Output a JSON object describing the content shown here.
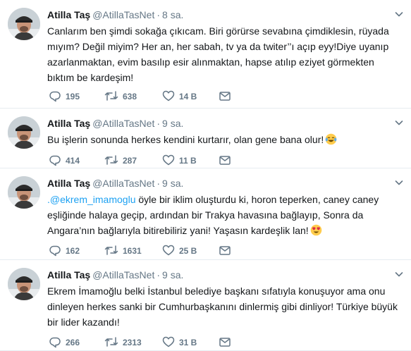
{
  "tweets": [
    {
      "name": "Atilla Taş",
      "handle": "@AtillaTasNet",
      "separator": "·",
      "time": "8 sa.",
      "mention": "",
      "text": "Canlarım ben şimdi sokağa çıkıcam. Biri görürse sevabına çimdiklesin, rüyada mıyım? Değil miyim? Her an, her sabah, tv ya da twiter’’ı açıp eyy!Diye uyanıp azarlanmaktan, evim basılıp esir alınmaktan, hapse atılıp eziyet görmekten bıktım be kardeşim!",
      "emoji": "",
      "replies": "195",
      "retweets": "638",
      "likes": "14 B"
    },
    {
      "name": "Atilla Taş",
      "handle": "@AtillaTasNet",
      "separator": "·",
      "time": "9 sa.",
      "mention": "",
      "text": "Bu işlerin sonunda herkes kendini kurtarır, olan gene bana olur!",
      "emoji": "tears-of-joy-emoji",
      "replies": "414",
      "retweets": "287",
      "likes": "11 B"
    },
    {
      "name": "Atilla Taş",
      "handle": "@AtillaTasNet",
      "separator": "·",
      "time": "9 sa.",
      "mention": ".@ekrem_imamoglu",
      "text": " öyle bir iklim oluşturdu ki, horon teperken, caney caney eşliğinde halaya geçip, ardından bir Trakya havasına bağlayıp, Sonra da Angara’nın bağlarıyla bitirebiliriz yani! Yaşasın kardeşlik lan!",
      "emoji": "heart-eyes-emoji",
      "replies": "162",
      "retweets": "1631",
      "likes": "25 B"
    },
    {
      "name": "Atilla Taş",
      "handle": "@AtillaTasNet",
      "separator": "·",
      "time": "9 sa.",
      "mention": "",
      "text": "Ekrem İmamoğlu belki İstanbul belediye başkanı sıfatıyla konuşuyor ama onu dinleyen herkes sanki bir Cumhurbaşkanını dinlermiş gibi dinliyor! Türkiye büyük bir lider kazandı!",
      "emoji": "",
      "replies": "266",
      "retweets": "2313",
      "likes": "31 B"
    }
  ],
  "colors": {
    "link": "#1da1f2",
    "meta": "#657786",
    "text": "#14171a",
    "divider": "#e6ecf0"
  },
  "icons": [
    "reply-icon",
    "retweet-icon",
    "like-icon",
    "direct-message-icon",
    "chevron-down-icon"
  ]
}
